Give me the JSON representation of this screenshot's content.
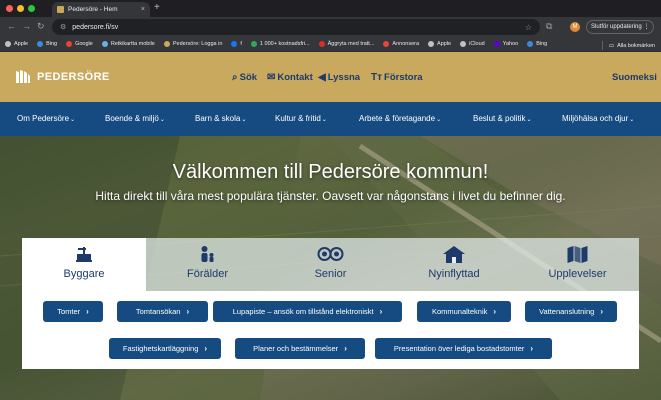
{
  "browser": {
    "tab_title": "Pedersöre - Hem",
    "tab_close": "×",
    "new_tab": "+",
    "url": "pedersore.fi/sv",
    "profile_initial": "M",
    "update_label": "Slutför uppdatering",
    "menu_icon": "⋮",
    "bookmarks": [
      {
        "label": "Apple",
        "color": "#bdc1c6"
      },
      {
        "label": "Bing",
        "color": "#3c8bd9"
      },
      {
        "label": "Google",
        "color": "#ea4335"
      },
      {
        "label": "Retkikartta mobile",
        "color": "#6bb0e0"
      },
      {
        "label": "Pedersöre: Logga in",
        "color": "#c8a95d"
      },
      {
        "label": "f",
        "color": "#1877f2"
      },
      {
        "label": "1 000+ kostnadsfri...",
        "color": "#34a853"
      },
      {
        "label": "Äggryta med tratt...",
        "color": "#d93025"
      },
      {
        "label": "Annonsera",
        "color": "#e8453c"
      },
      {
        "label": "Apple",
        "color": "#bdc1c6"
      },
      {
        "label": "iCloud",
        "color": "#bdc1c6"
      },
      {
        "label": "Yahoo",
        "color": "#6001d2"
      },
      {
        "label": "Bing",
        "color": "#3c8bd9"
      }
    ],
    "all_bookmarks": "Alla bokmärken"
  },
  "site": {
    "logo_text": "PEDERSÖRE",
    "utility": {
      "search": "Sök",
      "contact": "Kontakt",
      "listen": "Lyssna",
      "zoom": "Förstora",
      "language": "Suomeksi"
    },
    "nav": [
      "Om Pedersöre",
      "Boende & miljö",
      "Barn & skola",
      "Kultur & fritid",
      "Arbete & företagande",
      "Beslut & politik",
      "Miljöhälsa och djur"
    ],
    "nav_caret": "⌄",
    "hero": {
      "title": "Välkommen till Pedersöre kommun!",
      "subtitle": "Hitta direkt till våra mest populära tjänster. Oavsett var någonstans i livet du befinner dig."
    },
    "service_tabs": [
      {
        "label": "Byggare",
        "icon": "builder-icon",
        "active": true
      },
      {
        "label": "Förälder",
        "icon": "parent-icon",
        "active": false
      },
      {
        "label": "Senior",
        "icon": "senior-icon",
        "active": false
      },
      {
        "label": "Nyinflyttad",
        "icon": "house-icon",
        "active": false
      },
      {
        "label": "Upplevelser",
        "icon": "map-icon",
        "active": false
      }
    ],
    "service_buttons": [
      "Tomter",
      "Tomtansökan",
      "Lupapiste – ansök om tillstånd elektroniskt",
      "Kommunalteknik",
      "Vattenanslutning",
      "Fastighetskartläggning",
      "Planer och bestämmelser",
      "Presentation över lediga bostadstomter"
    ],
    "button_arrow": "›"
  },
  "colors": {
    "header_gold": "#c8a95d",
    "nav_blue": "#154b80",
    "text_navy": "#1e3a6b"
  }
}
